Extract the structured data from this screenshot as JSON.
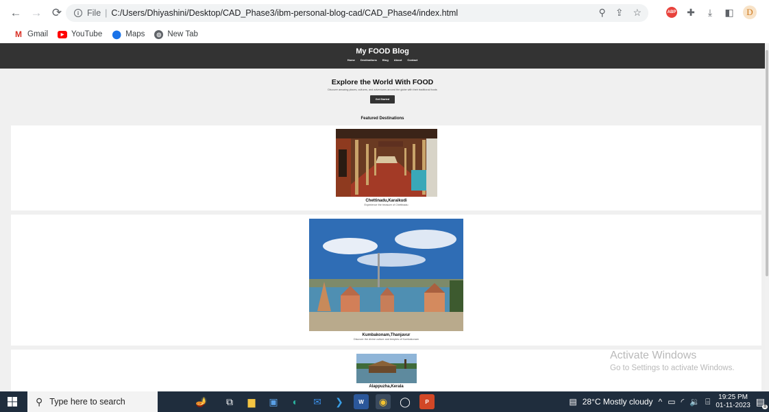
{
  "browser": {
    "file_label": "File",
    "url": "C:/Users/Dhiyashini/Desktop/CAD_Phase3/ibm-personal-blog-cad/CAD_Phase4/index.html",
    "profile_letter": "D",
    "abp_label": "ABP",
    "bookmarks": [
      {
        "label": "Gmail",
        "icon": "gmail-icon"
      },
      {
        "label": "YouTube",
        "icon": "youtube-icon"
      },
      {
        "label": "Maps",
        "icon": "maps-icon"
      },
      {
        "label": "New Tab",
        "icon": "new-tab-icon"
      }
    ]
  },
  "site": {
    "title": "My FOOD Blog",
    "nav": [
      "Home",
      "Destinations",
      "Blog",
      "About",
      "Contact"
    ],
    "hero_title": "Explore the World With FOOD",
    "hero_subtitle": "Discover amazing places, cultures, and adventures around the globe with their traditional foods",
    "hero_button": "Get Started",
    "featured_title": "Featured Destinations",
    "destinations": [
      {
        "name": "Chettinadu,Karaikudi",
        "description": "Experience the treasure of Chettinadu"
      },
      {
        "name": "Kumbakonam,Thanjavur",
        "description": "Discover the divine culture and temples of Kumbakonam"
      },
      {
        "name": "Alappuzha,Kerala",
        "description": ""
      }
    ]
  },
  "watermark": {
    "title": "Activate Windows",
    "subtitle": "Go to Settings to activate Windows."
  },
  "taskbar": {
    "search_placeholder": "Type here to search",
    "weather": "28°C  Mostly cloudy",
    "time": "19:25 PM",
    "date": "01-11-2023",
    "notification_count": "8"
  },
  "colors": {
    "header_bg": "#333333",
    "page_bg": "#f0f0f0",
    "taskbar_bg": "#1f2d3d"
  }
}
